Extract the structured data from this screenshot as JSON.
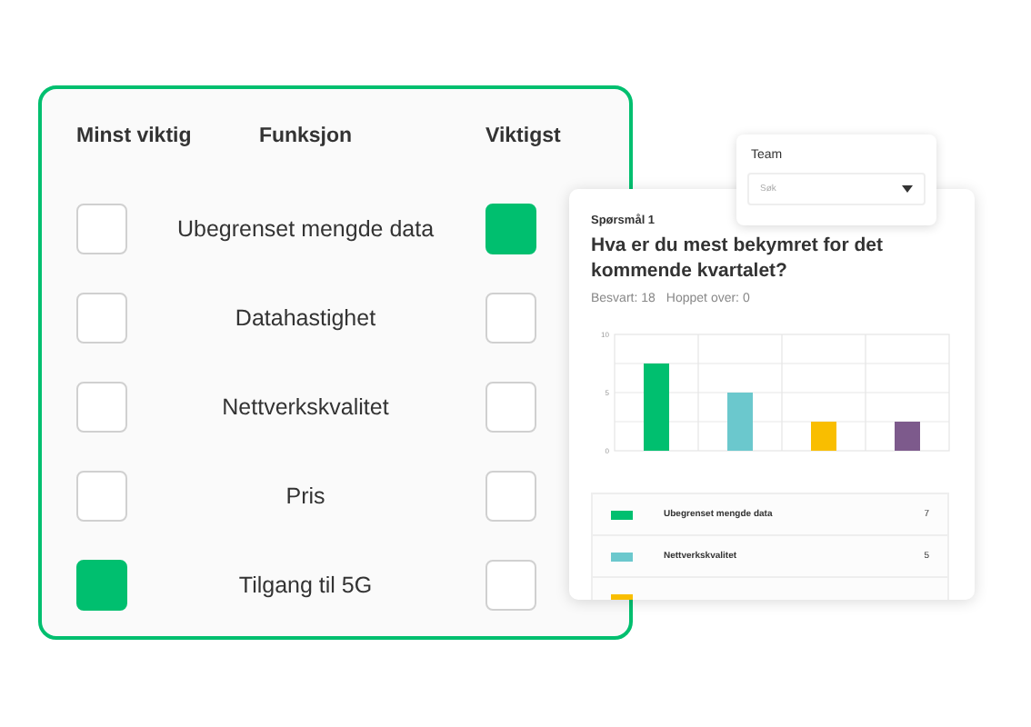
{
  "ranking": {
    "headers": [
      "Minst viktig",
      "Funksjon",
      "Viktigst"
    ],
    "rows": [
      {
        "label": "Ubegrenset mengde data",
        "least_checked": false,
        "most_checked": true
      },
      {
        "label": "Datahastighet",
        "least_checked": false,
        "most_checked": false
      },
      {
        "label": "Nettverkskvalitet",
        "least_checked": false,
        "most_checked": false
      },
      {
        "label": "Pris",
        "least_checked": false,
        "most_checked": false
      },
      {
        "label": "Tilgang til 5G",
        "least_checked": true,
        "most_checked": false
      }
    ]
  },
  "team_filter": {
    "label": "Team",
    "placeholder": "Søk"
  },
  "results": {
    "question_number": "Spørsmål 1",
    "question": "Hva er du mest bekymret for det kommende kvartalet?",
    "answered": "Besvart: 18",
    "skipped": "Hoppet over: 0",
    "chart_data": {
      "type": "bar",
      "series": [
        {
          "color": "#00bf6f",
          "values": [
            7.5,
            null,
            null,
            null
          ]
        },
        {
          "color": "#6bc8cd",
          "values": [
            null,
            5,
            null,
            null
          ]
        },
        {
          "color": "#f9be00",
          "values": [
            null,
            null,
            2.5,
            null
          ]
        },
        {
          "color": "#7d5a8c",
          "values": [
            null,
            null,
            null,
            2.5
          ]
        }
      ],
      "ylim": [
        0,
        10
      ],
      "yticks": [
        0,
        5,
        10
      ]
    },
    "legend": [
      {
        "name": "Ubegrenset mengde data",
        "value": "7",
        "color": "#00bf6f"
      },
      {
        "name": "Nettverkskvalitet",
        "value": "5",
        "color": "#6bc8cd"
      },
      {
        "color": "#f9be00"
      }
    ]
  }
}
